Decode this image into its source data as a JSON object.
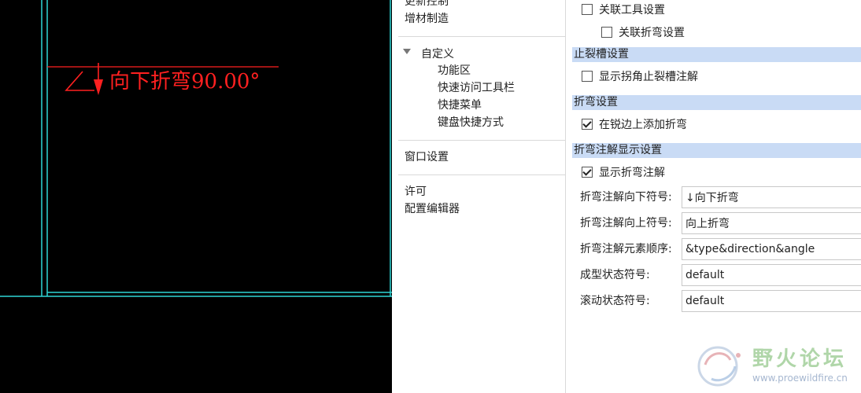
{
  "viewport": {
    "annotation_text": "向下折弯90.00°",
    "colors": {
      "background": "#000000",
      "annotation": "#ff2020",
      "edges": "#2fd6d6"
    }
  },
  "nav": {
    "items": [
      {
        "label": "更新控制"
      },
      {
        "label": "增材制造"
      },
      {
        "label": "自定义",
        "expanded": true
      },
      {
        "label": "功能区"
      },
      {
        "label": "快速访问工具栏"
      },
      {
        "label": "快捷菜单"
      },
      {
        "label": "键盘快捷方式"
      },
      {
        "label": "窗口设置"
      },
      {
        "label": "许可"
      },
      {
        "label": "配置编辑器"
      }
    ]
  },
  "settings": {
    "top_rows": [
      {
        "label": "关联工具设置",
        "checked": false
      },
      {
        "label": "关联折弯设置",
        "checked": false
      }
    ],
    "sections": [
      {
        "title": "止裂槽设置",
        "rows": [
          {
            "label": "显示拐角止裂槽注解",
            "checked": false
          }
        ]
      },
      {
        "title": "折弯设置",
        "rows": [
          {
            "label": "在锐边上添加折弯",
            "checked": true
          }
        ]
      },
      {
        "title": "折弯注解显示设置",
        "rows": [
          {
            "label": "显示折弯注解",
            "checked": true
          }
        ]
      }
    ],
    "fields": [
      {
        "label": "折弯注解向下符号:",
        "value": "↓向下折弯"
      },
      {
        "label": "折弯注解向上符号:",
        "value": "向上折弯"
      },
      {
        "label": "折弯注解元素顺序:",
        "value": "&type&direction&angle"
      },
      {
        "label": "成型状态符号:",
        "value": "default"
      },
      {
        "label": "滚动状态符号:",
        "value": "default"
      }
    ],
    "colors": {
      "section_header": "#c9dbf5"
    }
  },
  "watermark": {
    "title": "野火论坛",
    "url": "www.proewildfire.cn"
  }
}
